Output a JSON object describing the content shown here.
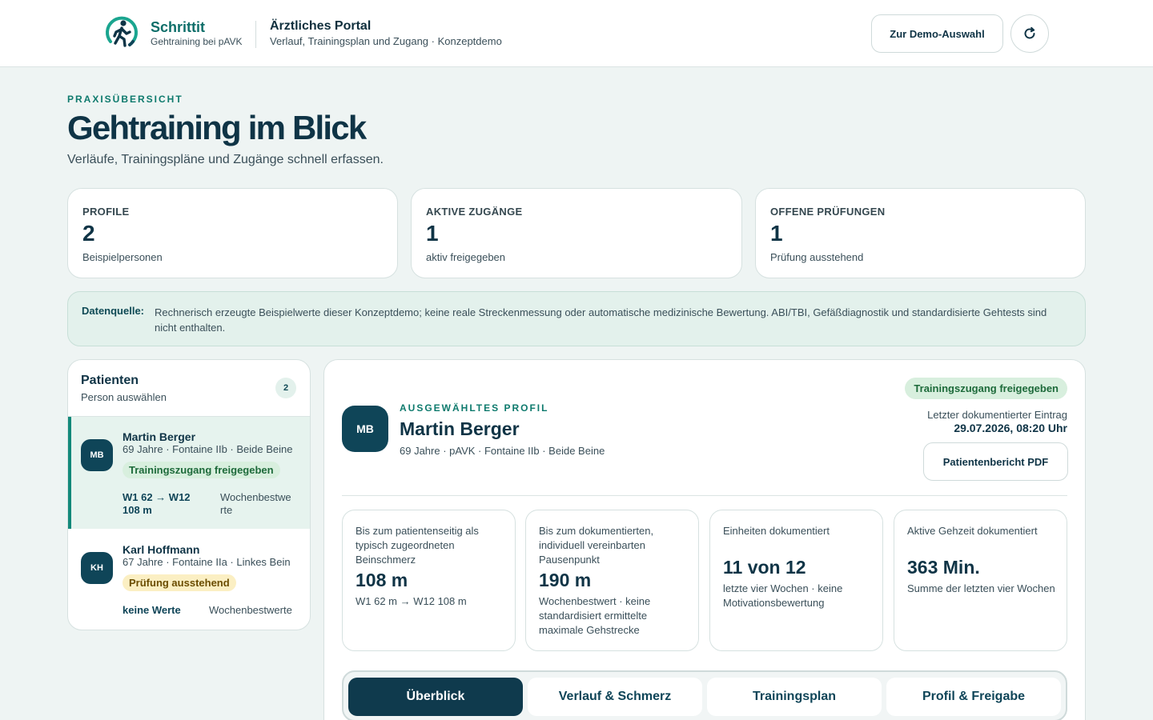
{
  "brand": {
    "name": "Schrittit",
    "sub": "Gehtraining bei pAVK"
  },
  "portal": {
    "title": "Ärztliches Portal",
    "sub": "Verlauf, Trainingsplan und Zugang · Konzeptdemo"
  },
  "header": {
    "demo_button": "Zur Demo-Auswahl",
    "refresh_icon": "refresh-icon",
    "logo_icon": "walking-person-icon"
  },
  "overview": {
    "eyebrow": "PRAXISÜBERSICHT",
    "title": "Gehtraining im Blick",
    "subtitle": "Verläufe, Trainingspläne und Zugänge schnell erfassen."
  },
  "stats": [
    {
      "label": "PROFILE",
      "value": "2",
      "sub": "Beispielpersonen"
    },
    {
      "label": "AKTIVE ZUGÄNGE",
      "value": "1",
      "sub": "aktiv freigegeben"
    },
    {
      "label": "OFFENE PRÜFUNGEN",
      "value": "1",
      "sub": "Prüfung ausstehend"
    }
  ],
  "source": {
    "label": "Datenquelle:",
    "text": "Rechnerisch erzeugte Beispielwerte dieser Konzeptdemo; keine reale Streckenmessung oder automatische medizinische Bewertung. ABI/TBI, Gefäßdiagnostik und standardisierte Gehtests sind nicht enthalten."
  },
  "patients": {
    "title": "Patienten",
    "subtitle": "Person auswählen",
    "count": "2",
    "items": [
      {
        "initials": "MB",
        "name": "Martin Berger",
        "meta": "69 Jahre · Fontaine IIb · Beide Beine",
        "status": "Trainingszugang freigegeben",
        "value_line1": "W1 62 → W12",
        "value_line2": "108 m",
        "value_label_line1": "Wochenbestwe",
        "value_label_line2": "rte"
      },
      {
        "initials": "KH",
        "name": "Karl Hoffmann",
        "meta": "67 Jahre · Fontaine IIa · Linkes Bein",
        "status": "Prüfung ausstehend",
        "value_line1": "keine Werte",
        "value_label_line1": "Wochenbestwerte"
      }
    ]
  },
  "detail": {
    "initials": "MB",
    "eyebrow": "AUSGEWÄHLTES PROFIL",
    "name": "Martin Berger",
    "meta": "69 Jahre · pAVK · Fontaine IIb · Beide Beine",
    "status": "Trainingszugang freigegeben",
    "last_entry_label": "Letzter dokumentierter Eintrag",
    "last_entry_value": "29.07.2026, 08:20 Uhr",
    "pdf_button": "Patientenbericht PDF",
    "kpis": [
      {
        "label": "Bis zum patientenseitig als typisch zugeordneten Beinschmerz",
        "value": "108 m",
        "sub": "W1 62 m → W12 108 m"
      },
      {
        "label": "Bis zum dokumentierten, individuell vereinbarten Pausenpunkt",
        "value": "190 m",
        "sub": "Wochenbestwert · keine standardisiert ermittelte maximale Gehstrecke"
      },
      {
        "label": "Einheiten dokumentiert",
        "value": "11 von 12",
        "sub": "letzte vier Wochen · keine Motivationsbewertung"
      },
      {
        "label": "Aktive Gehzeit dokumentiert",
        "value": "363 Min.",
        "sub": "Summe der letzten vier Wochen"
      }
    ],
    "tabs": [
      {
        "label": "Überblick",
        "active": true
      },
      {
        "label": "Verlauf & Schmerz",
        "active": false
      },
      {
        "label": "Trainingsplan",
        "active": false
      },
      {
        "label": "Profil & Freigabe",
        "active": false
      }
    ]
  },
  "colors": {
    "brand": "#0e6e69",
    "accent_dark": "#0f3a4d",
    "success_bg": "#d8efde",
    "warning_bg": "#fbefc3",
    "page_bg": "#eef4f3"
  }
}
